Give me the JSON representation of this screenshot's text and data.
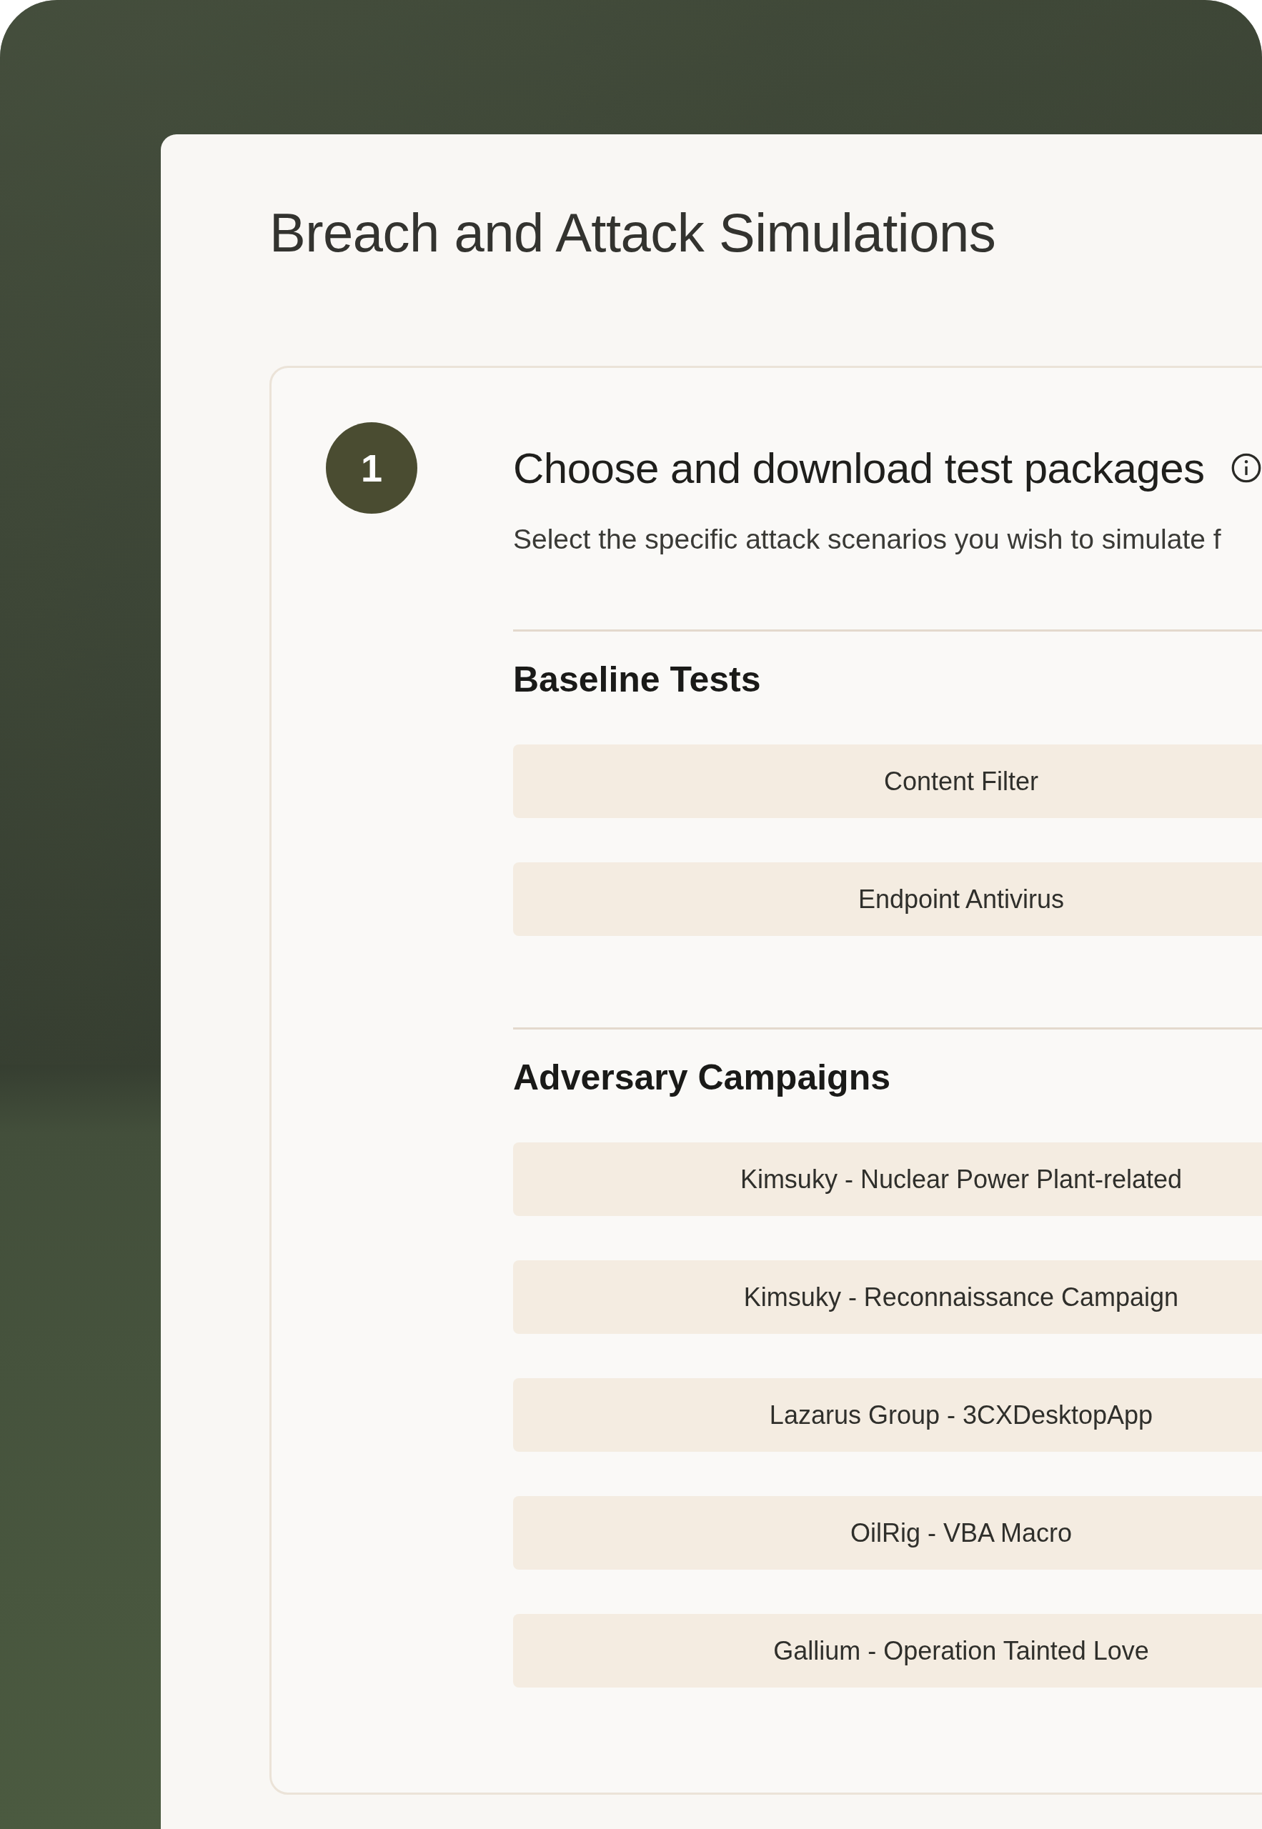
{
  "page": {
    "title": "Breach and Attack Simulations"
  },
  "step": {
    "number": "1",
    "title": "Choose and download test packages",
    "description": "Select the specific attack scenarios you wish to simulate f"
  },
  "sections": [
    {
      "title": "Baseline Tests",
      "packages": [
        "Content Filter",
        "Endpoint Antivirus"
      ]
    },
    {
      "title": "Adversary Campaigns",
      "packages": [
        "Kimsuky - Nuclear Power Plant-related",
        "Kimsuky - Reconnaissance Campaign",
        "Lazarus Group - 3CXDesktopApp",
        "OilRig - VBA Macro",
        "Gallium - Operation Tainted Love"
      ]
    }
  ]
}
